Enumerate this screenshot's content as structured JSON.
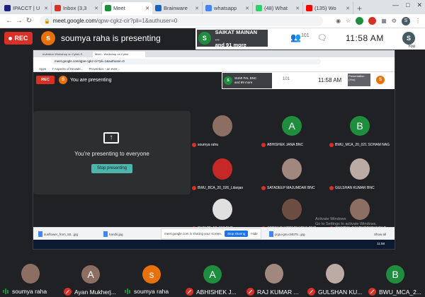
{
  "browser": {
    "tabs": [
      {
        "label": "IPACCT | U",
        "color": "#1a237e",
        "active": false
      },
      {
        "label": "Inbox (3,3",
        "color": "#d93025",
        "active": false
      },
      {
        "label": "Meet",
        "color": "#1e8e3e",
        "active": true
      },
      {
        "label": "Brainware",
        "color": "#1565c0",
        "active": false
      },
      {
        "label": "whatsapp",
        "color": "#4285f4",
        "active": false
      },
      {
        "label": "(48) What",
        "color": "#25d366",
        "active": false
      },
      {
        "label": "(135) Wo",
        "color": "#ff0000",
        "active": false
      }
    ],
    "url_host": "meet.google.com",
    "url_path": "/qpw-cgkz-cir?pli=1&authuser=0",
    "profile_initial": "S"
  },
  "meet": {
    "rec_label": "REC",
    "presenter_initial": "s",
    "presenter_text": "soumya raha is presenting",
    "viewer_initial": "S",
    "viewer_line1": "SAIKAT MAINAN ...",
    "viewer_line2": "and 91 more",
    "people_count": "101",
    "clock": "11:58 AM",
    "you_initial": "S",
    "you_label": "You"
  },
  "shared": {
    "tabs": [
      "Invitation Workshop on Cyber S",
      "Meet - Workshop on Cyber"
    ],
    "url": "meet.google.com/qpw-cgkz-cir?pli=1&authuser=0",
    "bookmarks": [
      "Apps",
      "7 Aspects of Knowle...",
      "Proventics - an ever..."
    ],
    "rec_label": "REC",
    "presenter_initial": "S",
    "presenter_text": "You are presenting",
    "viewer_initial": "S",
    "viewer_line1": "SUMI PAL BNC",
    "viewer_line2": "and 89 more",
    "people_count": "101",
    "clock": "11:58 AM",
    "presentation_thumb": "Presentation (You)",
    "you_initial": "S",
    "present_text": "You're presenting to everyone",
    "stop_label": "Stop presenting",
    "tiles": [
      {
        "name": "soumya raha",
        "initial": "",
        "color": "#8d6e63",
        "photo": true
      },
      {
        "name": "ABHISHEK JANA BNC",
        "initial": "A",
        "color": "#1e8e3e",
        "photo": false
      },
      {
        "name": "BWU_MCA_20_021 SOHAM NAG",
        "initial": "B",
        "color": "#1e8e3e",
        "photo": false
      },
      {
        "name": "BWU_BCA_20_026_Lilanjan",
        "initial": "",
        "color": "#c62828",
        "photo": true
      },
      {
        "name": "SATADEEP MAJUMDAR BNC",
        "initial": "",
        "color": "#a1887f",
        "photo": true
      },
      {
        "name": "GULSHAN KUMAR BNC",
        "initial": "",
        "color": "#bcaaa4",
        "photo": true
      },
      {
        "name": "SHAHID_19_013 BHN",
        "initial": "",
        "color": "#e0e0e0",
        "photo": true
      },
      {
        "name": "ARPAN BHATTACHARYA BNC",
        "initial": "",
        "color": "#6d4c41",
        "photo": true
      },
      {
        "name": "SWAPNIL BANDYOPADHYAY B",
        "initial": "",
        "color": "#8d6e63",
        "photo": true
      }
    ],
    "downloads": [
      "sunflower_from_50...jpg",
      "hands.jpg",
      "pcpu-gnu-34075...jpg"
    ],
    "share_text": "meet.google.com is sharing your screen.",
    "share_stop": "Stop sharing",
    "share_hide": "Hide",
    "show_all": "Show all",
    "activate_line1": "Activate Windows",
    "activate_line2": "Go to Settings to activate Windows.",
    "taskbar_clock": "11:58"
  },
  "filmstrip": [
    {
      "name": "soumya raha",
      "initial": "",
      "color": "#8d6e63",
      "photo": true,
      "state": "speaking"
    },
    {
      "name": "Ayan Mukherj...",
      "initial": "A",
      "color": "#8d6e63",
      "photo": false,
      "state": "muted"
    },
    {
      "name": "soumya raha",
      "initial": "s",
      "color": "#e8710a",
      "photo": false,
      "state": "speaking"
    },
    {
      "name": "ABHISHEK J...",
      "initial": "A",
      "color": "#1e8e3e",
      "photo": false,
      "state": "muted"
    },
    {
      "name": "RAJ KUMAR ...",
      "initial": "",
      "color": "#a1887f",
      "photo": true,
      "state": "muted"
    },
    {
      "name": "GULSHAN KU...",
      "initial": "",
      "color": "#bcaaa4",
      "photo": true,
      "state": "muted"
    },
    {
      "name": "BWU_MCA_2...",
      "initial": "B",
      "color": "#1e8e3e",
      "photo": false,
      "state": "muted"
    }
  ]
}
